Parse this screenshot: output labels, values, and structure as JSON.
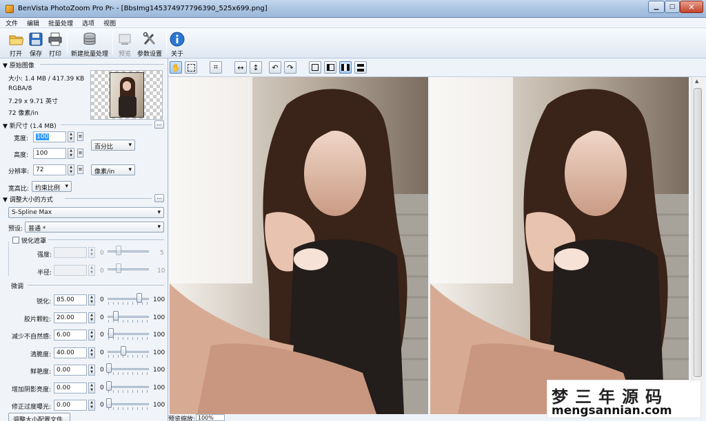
{
  "window": {
    "title": "BenVista PhotoZoom Pro Pr- - [BbsImg145374977796390_525x699.png]",
    "buttons": {
      "minimize": "▁",
      "maximize": "□",
      "close": "✕"
    }
  },
  "menu": [
    "文件",
    "编辑",
    "批量处理",
    "选项",
    "视图"
  ],
  "toolbar": {
    "open": "打开",
    "save": "保存",
    "print": "打印",
    "new_batch": "新建批量处理",
    "preview": "预览",
    "settings": "参数设置",
    "about": "关于"
  },
  "original": {
    "header": "▼ 原始图像",
    "size": "大小: 1.4 MB / 417.39 KB",
    "mode": "RGBA/8",
    "dims": "7.29 x 9.71 英寸",
    "res": "72 像素/in"
  },
  "new_size": {
    "header": "▼ 新尺寸 (1.4 MB)",
    "width_label": "宽度:",
    "width_value": "100",
    "height_label": "高度:",
    "height_value": "100",
    "res_label": "分辨率:",
    "res_value": "72",
    "unit_percent": "百分比",
    "unit_res": "像素/in",
    "aspect_label": "宽高比:",
    "aspect_value": "约束比例",
    "ellipsis": "..."
  },
  "resize_method": {
    "header": "▼ 调整大小的方式",
    "method": "S-Spline Max",
    "preset_label": "预设:",
    "preset_value": "普通 *",
    "ellipsis": "..."
  },
  "unsharp": {
    "label": "锐化遮罩",
    "strength_label": "强度:",
    "strength_min": "0",
    "strength_max": "5",
    "radius_label": "半径:",
    "radius_min": "0",
    "radius_max": "10"
  },
  "fine_tune": {
    "label": "微调",
    "rows": [
      {
        "label": "锐化:",
        "value": "85.00",
        "min": "0",
        "max": "100",
        "level": 0.85
      },
      {
        "label": "胶片颗粒:",
        "value": "20.00",
        "min": "0",
        "max": "100",
        "level": 0.2
      },
      {
        "label": "减少不自然感:",
        "value": "6.00",
        "min": "0",
        "max": "100",
        "level": 0.06
      },
      {
        "label": "清脆度:",
        "value": "40.00",
        "min": "0",
        "max": "100",
        "level": 0.4
      },
      {
        "label": "鲜艳度:",
        "value": "0.00",
        "min": "0",
        "max": "100",
        "level": 0.0
      },
      {
        "label": "增加阴影亮度:",
        "value": "0.00",
        "min": "0",
        "max": "100",
        "level": 0.0
      },
      {
        "label": "修正过度曝光:",
        "value": "0.00",
        "min": "0",
        "max": "100",
        "level": 0.0
      }
    ]
  },
  "resize_profile_button": "调整大小配置文件",
  "status": {
    "label": "预览缩放:",
    "zoom": "100%"
  },
  "watermark": {
    "cn": "梦三年源码",
    "en": "mengsannian.com"
  },
  "colors": {
    "accent": "#3399ff",
    "title_bar": "#a9c3e2",
    "panel": "#f0f4f9"
  }
}
